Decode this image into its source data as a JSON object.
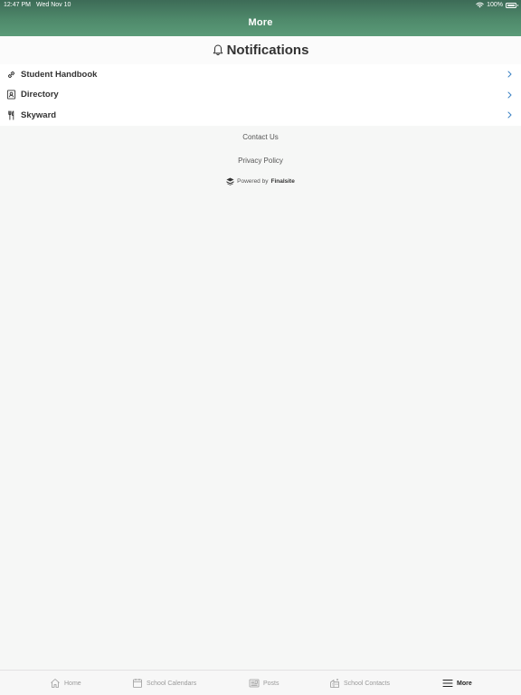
{
  "status_bar": {
    "time": "12:47 PM",
    "date": "Wed Nov 10",
    "battery": "100%"
  },
  "header": {
    "title": "More"
  },
  "notifications": {
    "title": "Notifications",
    "icon": "bell-icon"
  },
  "list": [
    {
      "label": "Student Handbook",
      "icon": "link-icon"
    },
    {
      "label": "Directory",
      "icon": "contact-card-icon"
    },
    {
      "label": "Skyward",
      "icon": "fork-knife-icon"
    }
  ],
  "footer": {
    "contact": "Contact Us",
    "privacy": "Privacy Policy",
    "powered_prefix": "Powered by",
    "powered_brand": "Finalsite"
  },
  "tabs": [
    {
      "label": "Home",
      "icon": "home-icon"
    },
    {
      "label": "School Calendars",
      "icon": "calendar-icon"
    },
    {
      "label": "Posts",
      "icon": "newspaper-icon"
    },
    {
      "label": "School Contacts",
      "icon": "building-icon"
    },
    {
      "label": "More",
      "icon": "menu-icon",
      "active": true
    }
  ],
  "colors": {
    "header_green": "#4f8a6b",
    "chevron_blue": "#3b82c4"
  }
}
